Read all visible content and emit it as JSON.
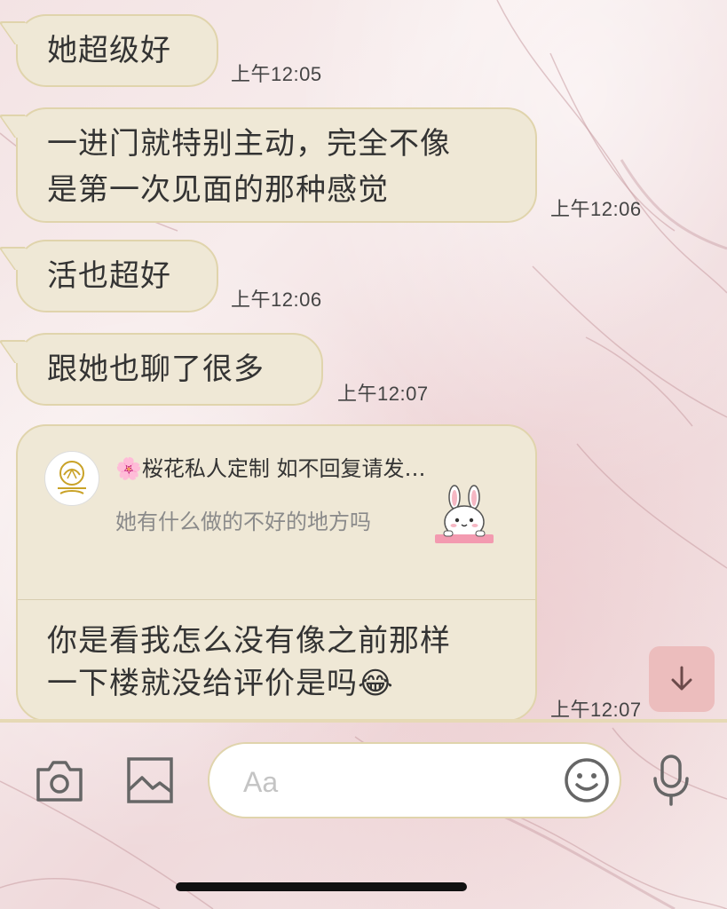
{
  "messages": [
    {
      "text": "她超级好",
      "time": "上午12:05"
    },
    {
      "text_line1": "一进门就特别主动，完全不像",
      "text_line2": "是第一次见面的那种感觉",
      "time": "上午12:06"
    },
    {
      "text": "活也超好",
      "time": "上午12:06"
    },
    {
      "text": "跟她也聊了很多",
      "time": "上午12:07"
    }
  ],
  "reply": {
    "quoted_sender": "🌸桜花私人定制 如不回复请发…",
    "quoted_text": "她有什么做的不好的地方吗",
    "text_line1": "你是看我怎么没有像之前那样",
    "text_line2": "一下楼就没给评价是吗😂",
    "time": "上午12:07"
  },
  "input": {
    "placeholder": "Aa",
    "value": ""
  },
  "icons": {
    "camera": "camera-icon",
    "gallery": "image-icon",
    "emoji": "smiley-icon",
    "mic": "microphone-icon",
    "scroll": "arrow-down-icon"
  },
  "colors": {
    "bubble": "#efe8d6",
    "bubble_border": "#e0d4ac",
    "scroll_button": "#ecbdbd"
  }
}
